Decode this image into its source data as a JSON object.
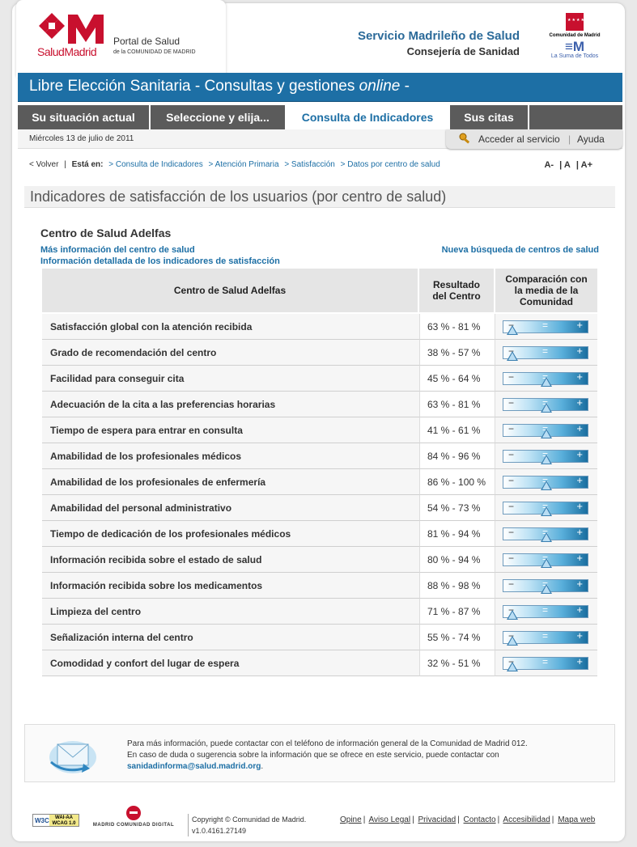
{
  "header": {
    "logo_salud": "Salud",
    "logo_madrid": "Madrid",
    "portal": "Portal de Salud",
    "portal_sub": "de la COMUNIDAD DE MADRID",
    "service_title": "Servicio Madrileño de Salud",
    "service_sub": "Consejería de Sanidad",
    "cm_label": "Comunidad de Madrid",
    "cm_suma": "La Suma de Todos"
  },
  "title_bar": {
    "main": "Libre Elección Sanitaria - Consultas y gestiones ",
    "online": "online",
    "end": " -"
  },
  "tabs": [
    {
      "label": "Su situación actual",
      "active": false
    },
    {
      "label": "Seleccione y elija...",
      "active": false
    },
    {
      "label": "Consulta de Indicadores",
      "active": true
    },
    {
      "label": "Sus citas",
      "active": false
    }
  ],
  "date": "Miércoles 13 de julio de 2011",
  "access": {
    "label": "Acceder al servicio",
    "help": "Ayuda"
  },
  "breadcrumb": {
    "back": "< Volver",
    "sep": "|",
    "here": "Está en:",
    "items": [
      "> Consulta de Indicadores",
      "> Atención Primaria",
      "> Satisfacción",
      "> Datos por centro de salud"
    ]
  },
  "font_controls": [
    "A-",
    "A",
    "A+"
  ],
  "page_title": "Indicadores de satisfacción de los usuarios (por centro de salud)",
  "center": {
    "name": "Centro de Salud Adelfas",
    "link_more": "Más información del centro de salud",
    "link_detail": "Información detallada de los indicadores de satisfacción",
    "link_new": "Nueva búsqueda de centros de salud"
  },
  "table": {
    "col_name": "Centro de Salud Adelfas",
    "col_result": [
      "Resultado",
      "del Centro"
    ],
    "col_compare": [
      "Comparación con",
      "la media de la",
      "Comunidad"
    ],
    "scale": {
      "minus": "−",
      "equal": "=",
      "plus": "+"
    },
    "rows": [
      {
        "indicator": "Satisfacción global con la atención recibida",
        "result": "63 % - 81 %",
        "comparison": 0.1
      },
      {
        "indicator": "Grado de recomendación del centro",
        "result": "38 % - 57 %",
        "comparison": 0.1
      },
      {
        "indicator": "Facilidad para conseguir cita",
        "result": "45 % - 64 %",
        "comparison": 0.5
      },
      {
        "indicator": "Adecuación de la cita a las preferencias horarias",
        "result": "63 % - 81 %",
        "comparison": 0.5
      },
      {
        "indicator": "Tiempo de espera para entrar en consulta",
        "result": "41 % - 61 %",
        "comparison": 0.5
      },
      {
        "indicator": "Amabilidad de los profesionales médicos",
        "result": "84 % - 96 %",
        "comparison": 0.5
      },
      {
        "indicator": "Amabilidad de los profesionales de enfermería",
        "result": "86 % - 100 %",
        "comparison": 0.5
      },
      {
        "indicator": "Amabilidad del personal administrativo",
        "result": "54 % - 73 %",
        "comparison": 0.5
      },
      {
        "indicator": "Tiempo de dedicación de los profesionales médicos",
        "result": "81 % - 94 %",
        "comparison": 0.5
      },
      {
        "indicator": "Información recibida sobre el estado de salud",
        "result": "80 % - 94 %",
        "comparison": 0.5
      },
      {
        "indicator": "Información recibida sobre los medicamentos",
        "result": "88 % - 98 %",
        "comparison": 0.5
      },
      {
        "indicator": "Limpieza del centro",
        "result": "71 % - 87 %",
        "comparison": 0.1
      },
      {
        "indicator": "Señalización interna del centro",
        "result": "55 % - 74 %",
        "comparison": 0.1
      },
      {
        "indicator": "Comodidad y confort del lugar de espera",
        "result": "32 % - 51 %",
        "comparison": 0.1
      }
    ]
  },
  "info": {
    "line1": "Para más información, puede contactar con el teléfono de información general de la Comunidad de Madrid 012.",
    "line2": "En caso de duda o sugerencia sobre la información que se ofrece en este servicio, puede contactar con",
    "email": "sanidadinforma@salud.madrid.org",
    "dot": "."
  },
  "footer": {
    "w3c": "W3C",
    "wai": "WAI-AA",
    "wcag": "WCAG 1.0",
    "mcd": "MADRID COMUNIDAD DIGITAL",
    "copyright": "Copyright © Comunidad de Madrid.",
    "version": "v1.0.4161.27149",
    "links": [
      "Opine",
      "Aviso Legal",
      "Privacidad",
      "Contacto",
      "Accesibilidad",
      "Mapa web"
    ]
  },
  "colors": {
    "brand_blue": "#1d6fa5",
    "brand_red": "#c8102e",
    "tab_gray": "#5b5b5b"
  }
}
